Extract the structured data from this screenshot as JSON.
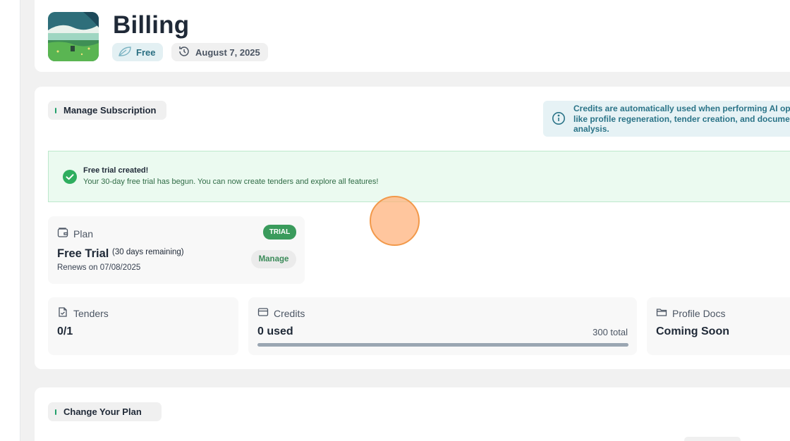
{
  "header": {
    "title": "Billing",
    "plan_chip": "Free",
    "date_chip": "August 7, 2025"
  },
  "subscription": {
    "section_label": "Manage Subscription",
    "info_lines": [
      "Credits are automatically used when performing AI op",
      "like profile regeneration, tender creation, and docume",
      "analysis."
    ],
    "alert": {
      "title": "Free trial created!",
      "message": "Your 30-day free trial has begun. You can now create tenders and explore all features!"
    },
    "plan": {
      "label": "Plan",
      "badge": "TRIAL",
      "name": "Free Trial",
      "remaining": "(30 days remaining)",
      "renews": "Renews on 07/08/2025",
      "manage_label": "Manage"
    },
    "stats": {
      "tenders": {
        "label": "Tenders",
        "value": "0/1"
      },
      "credits": {
        "label": "Credits",
        "value": "0 used",
        "total": "300 total",
        "used_fraction": 0
      },
      "profile_docs": {
        "label": "Profile Docs",
        "value": "Coming Soon"
      }
    }
  },
  "change_plan": {
    "section_label": "Change Your Plan"
  },
  "colors": {
    "accent_green": "#3a9b5c",
    "info_teal": "#2b7488",
    "title_text": "#1f2937"
  },
  "icons": [
    "landscape-avatar",
    "leaf-icon",
    "history-clock-icon",
    "info-icon",
    "check-circle-icon",
    "wallet-icon",
    "file-check-icon",
    "card-icon",
    "folder-icon"
  ]
}
